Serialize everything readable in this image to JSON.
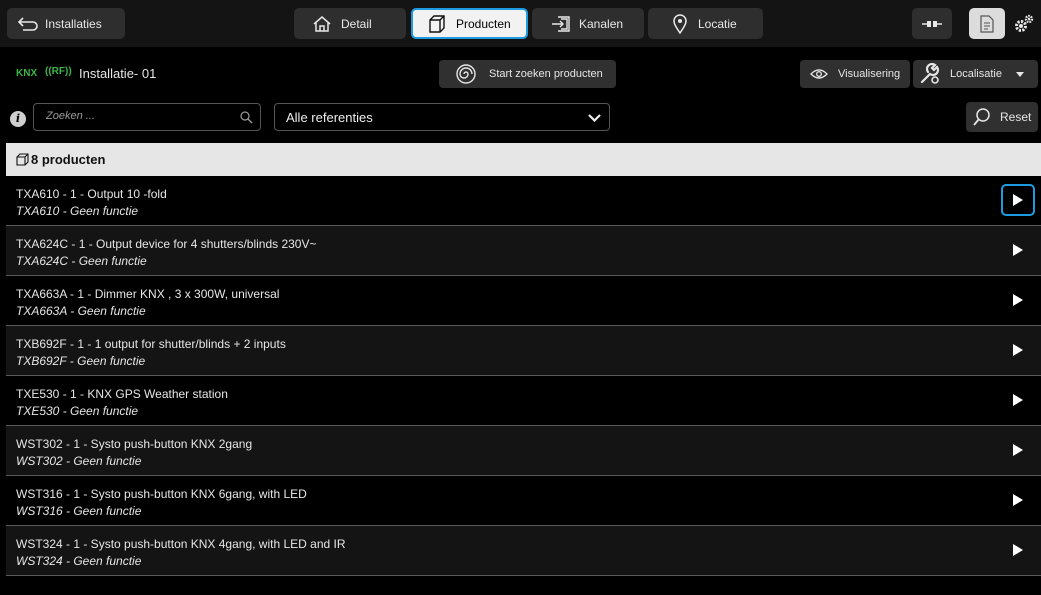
{
  "topbar": {
    "back_label": "Installaties",
    "tabs": [
      {
        "label": "Detail",
        "icon": "house-icon"
      },
      {
        "label": "Producten",
        "icon": "box-icon"
      },
      {
        "label": "Kanalen",
        "icon": "channels-icon"
      },
      {
        "label": "Locatie",
        "icon": "location-pin-icon"
      }
    ],
    "active_tab": "Producten"
  },
  "installation": {
    "protocol_badge": "KNX",
    "rf_badge": "((RF))",
    "name": "Installatie- 01",
    "start_search_label": "Start zoeken producten",
    "visualisation_label": "Visualisering",
    "localisation_label": "Localisatie"
  },
  "filter": {
    "info_glyph": "i",
    "search_placeholder": "Zoeken ...",
    "reference_selected": "Alle referenties",
    "reset_label": "Reset"
  },
  "products": {
    "header": "8 producten",
    "items": [
      {
        "title": "TXA610 - 1 - Output 10 -fold",
        "subtitle": "TXA610 - Geen functie"
      },
      {
        "title": "TXA624C - 1 - Output device for 4 shutters/blinds 230V~",
        "subtitle": "TXA624C - Geen functie"
      },
      {
        "title": "TXA663A - 1 - Dimmer KNX , 3 x 300W, universal",
        "subtitle": "TXA663A - Geen functie"
      },
      {
        "title": "TXB692F - 1 - 1 output for shutter/blinds + 2 inputs",
        "subtitle": "TXB692F - Geen functie"
      },
      {
        "title": "TXE530 - 1 - KNX GPS Weather station",
        "subtitle": "TXE530 - Geen functie"
      },
      {
        "title": "WST302 - 1 - Systo push-button KNX 2gang",
        "subtitle": "WST302 - Geen functie"
      },
      {
        "title": "WST316 - 1 - Systo push-button KNX 6gang, with LED",
        "subtitle": "WST316 - Geen functie"
      },
      {
        "title": "WST324 - 1 - Systo push-button KNX 4gang, with LED and IR",
        "subtitle": "WST324 - Geen functie"
      }
    ]
  },
  "colors": {
    "accent": "#1e9be0",
    "knx_green": "#3fb54a",
    "header_bg": "#e6e6e6"
  }
}
